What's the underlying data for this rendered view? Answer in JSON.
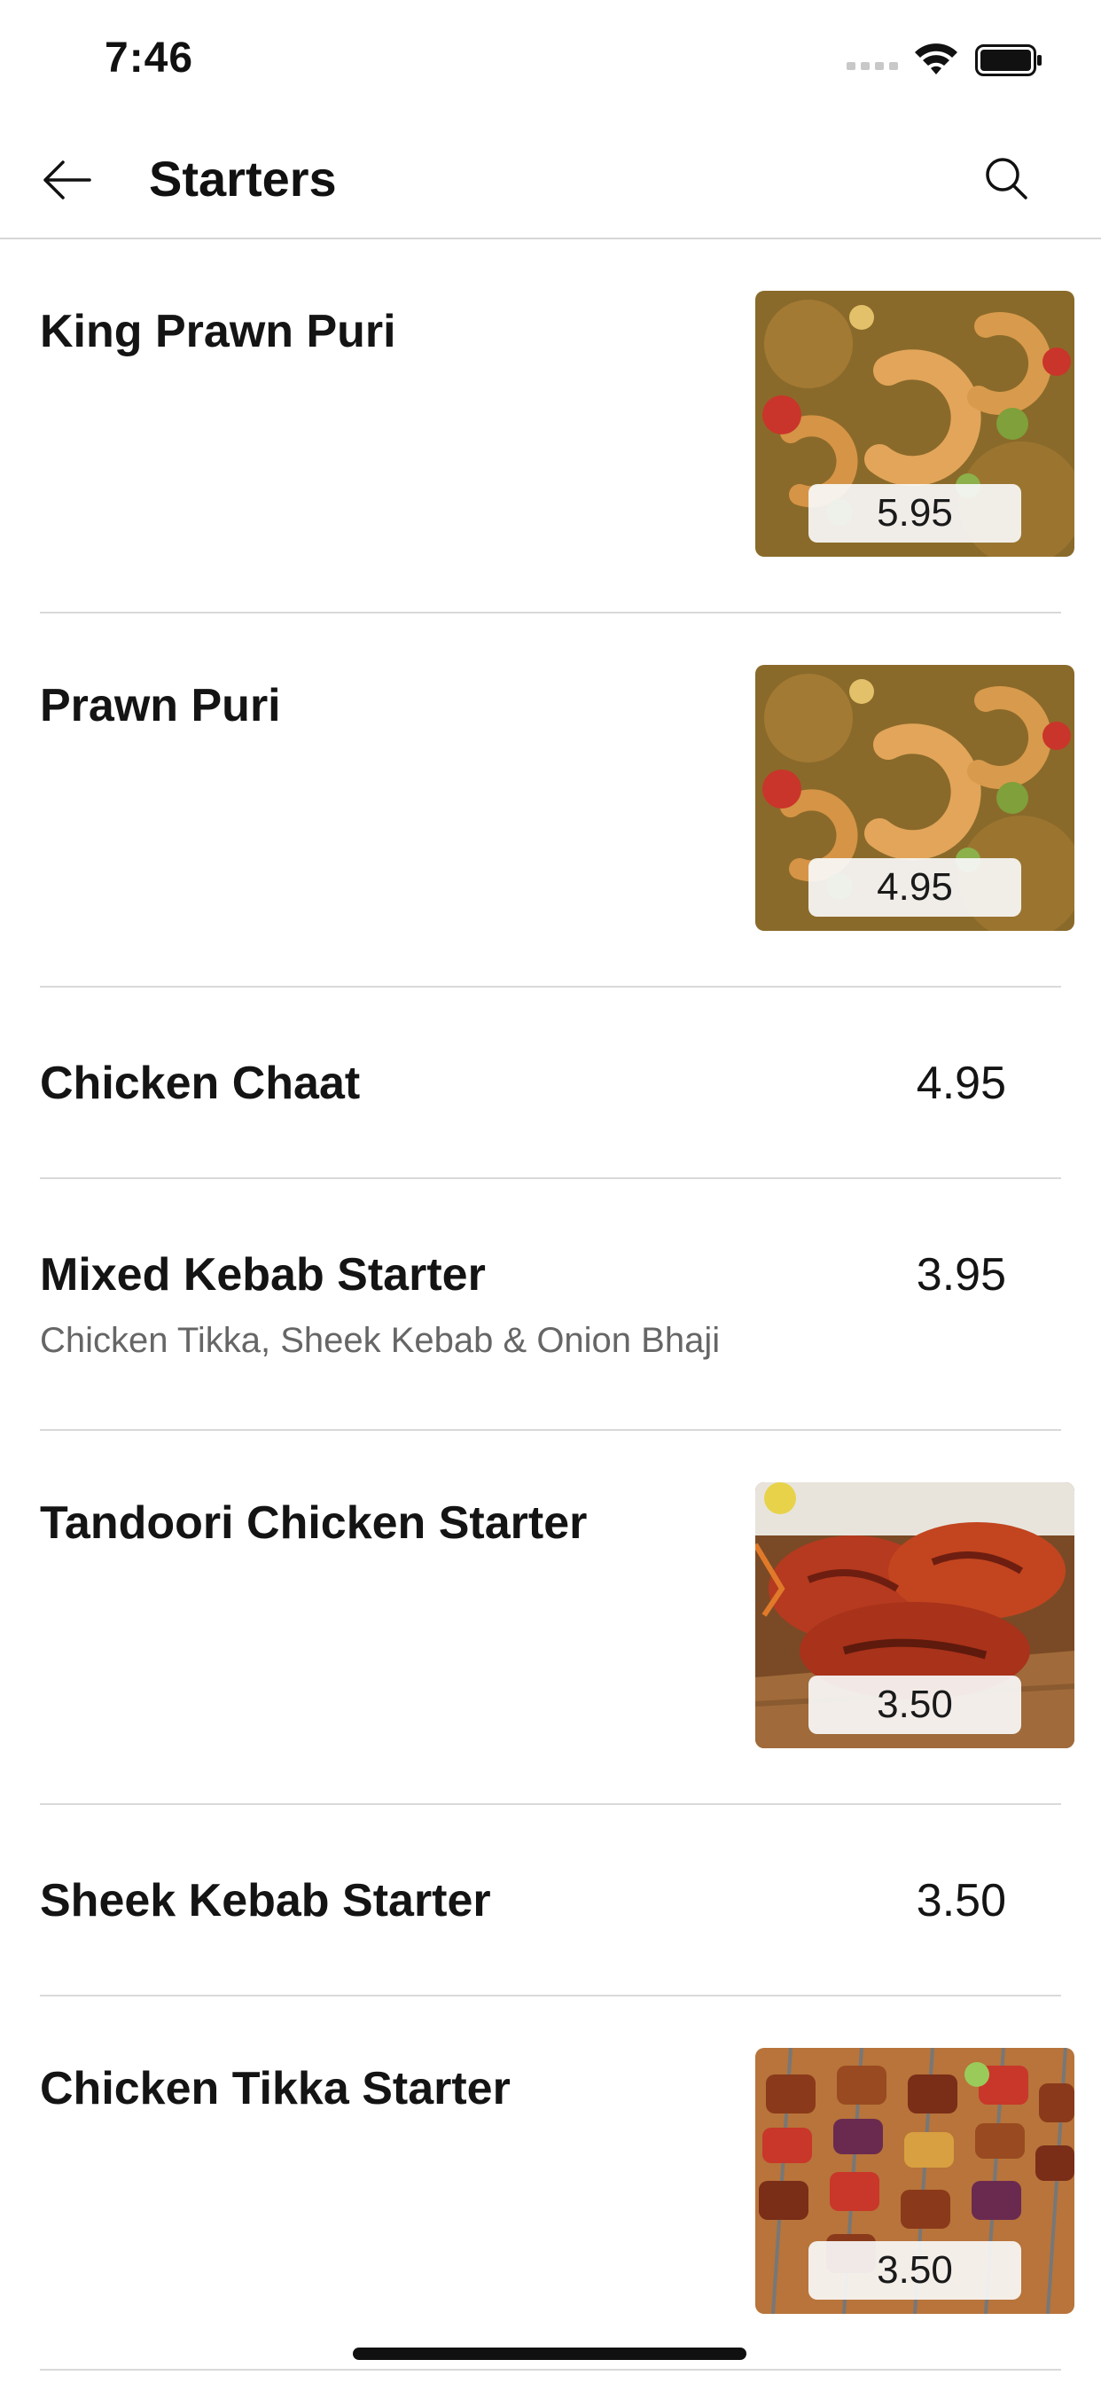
{
  "status_bar": {
    "time": "7:46",
    "icons": [
      "cellular-signal-icon",
      "wifi-icon",
      "battery-icon"
    ]
  },
  "nav": {
    "title": "Starters",
    "back_icon": "arrow-left-icon",
    "search_icon": "search-icon"
  },
  "items": [
    {
      "name": "King Prawn Puri",
      "price": "5.95",
      "image": "prawn-curry-photo"
    },
    {
      "name": "Prawn Puri",
      "price": "4.95",
      "image": "prawn-curry-photo"
    },
    {
      "name": "Chicken Chaat",
      "price": "4.95"
    },
    {
      "name": "Mixed Kebab Starter",
      "price": "3.95",
      "description": "Chicken Tikka, Sheek Kebab & Onion Bhaji"
    },
    {
      "name": "Tandoori Chicken Starter",
      "price": "3.50",
      "image": "tandoori-chicken-photo"
    },
    {
      "name": "Sheek Kebab Starter",
      "price": "3.50"
    },
    {
      "name": "Chicken Tikka Starter",
      "price": "3.50",
      "image": "chicken-tikka-skewers-photo"
    }
  ],
  "colors": {
    "text": "#141414",
    "description": "#666666",
    "divider": "#d9d9d9",
    "background": "#ffffff"
  }
}
